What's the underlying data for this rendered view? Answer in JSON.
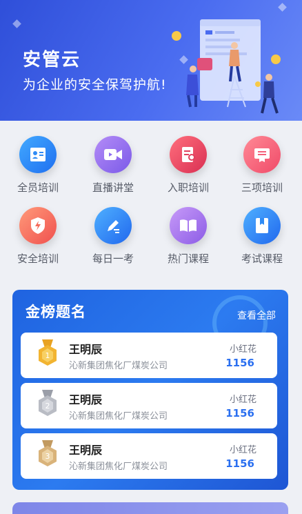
{
  "banner": {
    "brand": "安管云",
    "slogan": "为企业的安全保驾护航!"
  },
  "menu": [
    {
      "label": "全员培训",
      "icon": "id-card-icon",
      "color": "#2f8bf5"
    },
    {
      "label": "直播讲堂",
      "icon": "video-camera-icon",
      "color": "#8f6ef2"
    },
    {
      "label": "入职培训",
      "icon": "onboarding-doc-icon",
      "color": "#f0506a"
    },
    {
      "label": "三项培训",
      "icon": "certificate-icon",
      "color": "#f4607a"
    },
    {
      "label": "安全培训",
      "icon": "shield-lightning-icon",
      "color": "#f56a5a"
    },
    {
      "label": "每日一考",
      "icon": "pencil-icon",
      "color": "#2f8bf5"
    },
    {
      "label": "热门课程",
      "icon": "open-book-icon",
      "color": "#a86ef0"
    },
    {
      "label": "考试课程",
      "icon": "bookmark-book-icon",
      "color": "#2f8bf5"
    }
  ],
  "leaderboard": {
    "title": "金榜题名",
    "view_all": "查看全部",
    "entries": [
      {
        "rank": "1",
        "name": "王明辰",
        "org": "沁新集团焦化厂煤炭公司",
        "tag": "小红花",
        "score": "1156",
        "medal_color": "#f2b431"
      },
      {
        "rank": "2",
        "name": "王明辰",
        "org": "沁新集团焦化厂煤炭公司",
        "tag": "小红花",
        "score": "1156",
        "medal_color": "#b9bcc4"
      },
      {
        "rank": "3",
        "name": "王明辰",
        "org": "沁新集团焦化厂煤炭公司",
        "tag": "小红花",
        "score": "1156",
        "medal_color": "#d9b37a"
      }
    ]
  }
}
